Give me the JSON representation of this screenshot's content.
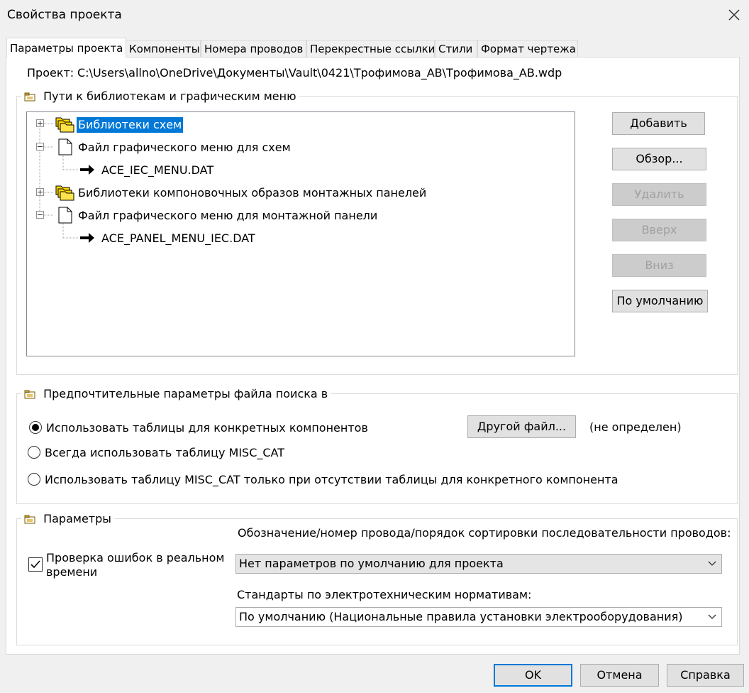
{
  "window": {
    "title": "Свойства проекта"
  },
  "tabs": [
    {
      "label": "Параметры проекта"
    },
    {
      "label": "Компоненты"
    },
    {
      "label": "Номера проводов"
    },
    {
      "label": "Перекрестные ссылки"
    },
    {
      "label": "Стили"
    },
    {
      "label": "Формат чертежа"
    }
  ],
  "project": {
    "label": "Проект:",
    "path": "C:\\Users\\allno\\OneDrive\\Документы\\Vault\\0421\\Трофимова_АВ\\Трофимова_АВ.wdp"
  },
  "libraries_group": {
    "title": "Пути к библиотекам и графическим меню",
    "tree": [
      {
        "label": "Библиотеки схем",
        "selected": true,
        "icon": "folder-stack-icon",
        "expander": "plus"
      },
      {
        "label": "Файл графического меню для схем",
        "icon": "document-icon",
        "expander": "minus"
      },
      {
        "label": "ACE_IEC_MENU.DAT",
        "icon": "arrow-right-icon"
      },
      {
        "label": "Библиотеки компоновочных образов монтажных панелей",
        "icon": "folder-stack-icon",
        "expander": "plus"
      },
      {
        "label": "Файл графического меню для монтажной панели",
        "icon": "document-icon",
        "expander": "minus"
      },
      {
        "label": "ACE_PANEL_MENU_IEC.DAT",
        "icon": "arrow-right-icon"
      }
    ],
    "buttons": {
      "add": "Добавить",
      "browse": "Обзор...",
      "delete": "Удалить",
      "up": "Вверх",
      "down": "Вниз",
      "default": "По умолчанию"
    }
  },
  "search_group": {
    "title": "Предпочтительные параметры файла поиска в",
    "options": [
      {
        "label": "Использовать таблицы для конкретных компонентов",
        "checked": true
      },
      {
        "label": "Всегда использовать таблицу MISC_CAT",
        "checked": false
      },
      {
        "label": "Использовать таблицу MISC_CAT только при отсутствии таблицы для конкретного компонента",
        "checked": false
      }
    ],
    "other_file_button": "Другой файл...",
    "other_file_status": "(не определен)"
  },
  "params_group": {
    "title": "Параметры",
    "realtime_check": {
      "label_line1": "Проверка ошибок в реальном",
      "label_line2": "времени",
      "checked": true
    },
    "wire_sort_label": "Обозначение/номер провода/порядок сортировки последовательности проводов:",
    "wire_sort_value": "Нет параметров по умолчанию для проекта",
    "standards_label": "Стандарты по электротехническим нормативам:",
    "standards_value": "По умолчанию (Национальные правила установки электрооборудования)"
  },
  "footer": {
    "ok": "OK",
    "cancel": "Отмена",
    "help": "Справка"
  },
  "colors": {
    "selection": "#0078d7",
    "folder": "#ffd700"
  }
}
